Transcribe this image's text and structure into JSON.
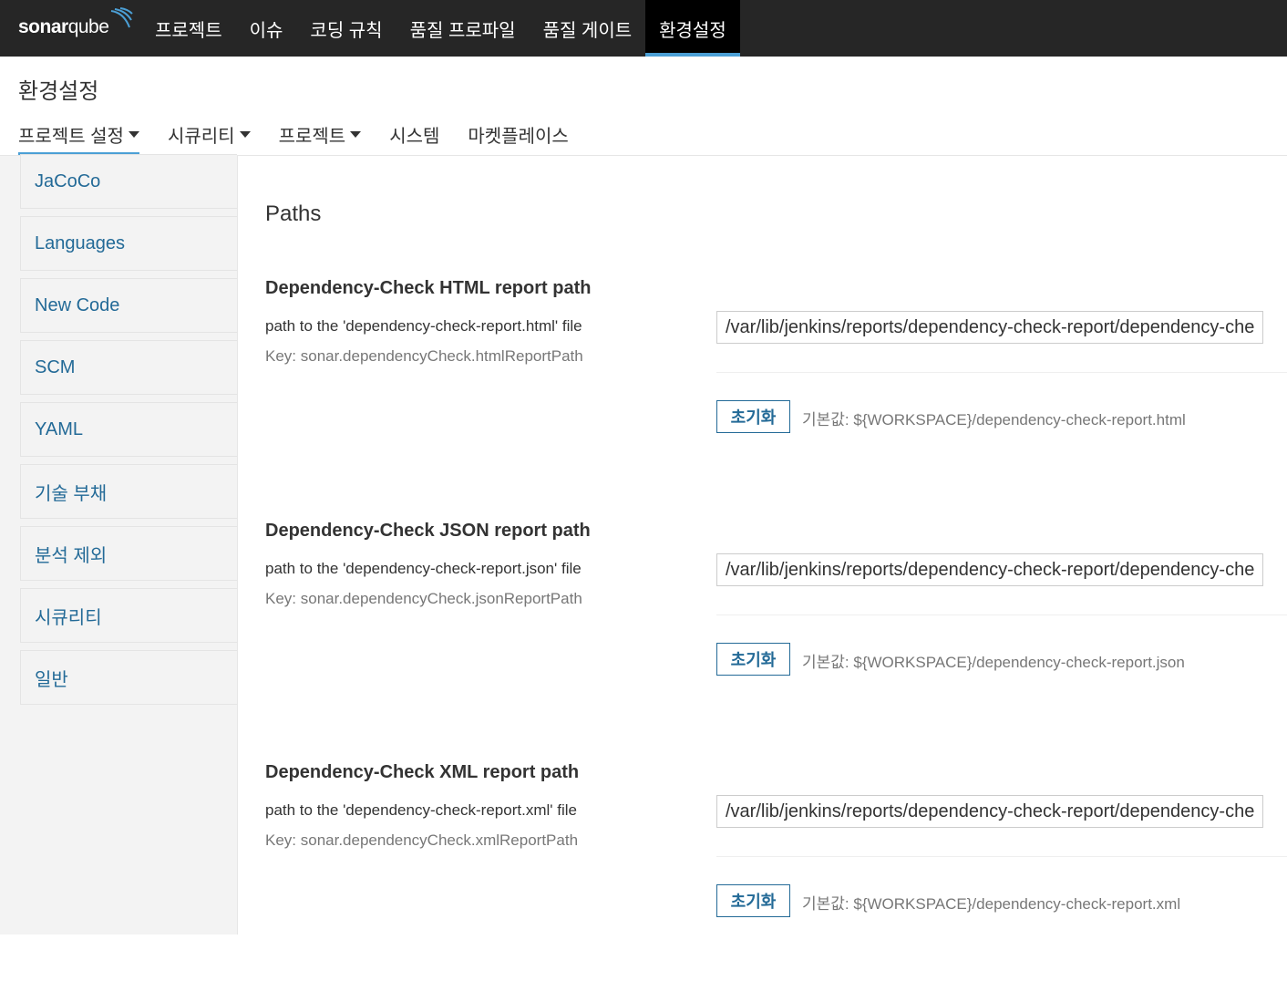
{
  "topbar": {
    "logo_text": "sonar",
    "logo_text2": "qube",
    "nav": [
      {
        "label": "프로젝트"
      },
      {
        "label": "이슈"
      },
      {
        "label": "코딩 규칙"
      },
      {
        "label": "품질 프로파일"
      },
      {
        "label": "품질 게이트"
      },
      {
        "label": "환경설정"
      }
    ],
    "active_index": 5
  },
  "page": {
    "title": "환경설정",
    "tabs": [
      {
        "label": "프로젝트 설정",
        "has_caret": true
      },
      {
        "label": "시큐리티",
        "has_caret": true
      },
      {
        "label": "프로젝트",
        "has_caret": true
      },
      {
        "label": "시스템",
        "has_caret": false
      },
      {
        "label": "마켓플레이스",
        "has_caret": false
      }
    ]
  },
  "sidebar": {
    "items": [
      {
        "label": "JaCoCo"
      },
      {
        "label": "Languages"
      },
      {
        "label": "New Code"
      },
      {
        "label": "SCM"
      },
      {
        "label": "YAML"
      },
      {
        "label": "기술 부채"
      },
      {
        "label": "분석 제외"
      },
      {
        "label": "시큐리티"
      },
      {
        "label": "일반"
      }
    ]
  },
  "main": {
    "section_title": "Paths",
    "settings": [
      {
        "name": "Dependency-Check HTML report path",
        "description": "path to the 'dependency-check-report.html' file",
        "key": "Key: sonar.dependencyCheck.htmlReportPath",
        "value": "/var/lib/jenkins/reports/dependency-check-report/dependency-check-report.html",
        "reset_label": "초기화",
        "default_text": "기본값: ${WORKSPACE}/dependency-check-report.html"
      },
      {
        "name": "Dependency-Check JSON report path",
        "description": "path to the 'dependency-check-report.json' file",
        "key": "Key: sonar.dependencyCheck.jsonReportPath",
        "value": "/var/lib/jenkins/reports/dependency-check-report/dependency-check-report.json",
        "reset_label": "초기화",
        "default_text": "기본값: ${WORKSPACE}/dependency-check-report.json"
      },
      {
        "name": "Dependency-Check XML report path",
        "description": "path to the 'dependency-check-report.xml' file",
        "key": "Key: sonar.dependencyCheck.xmlReportPath",
        "value": "/var/lib/jenkins/reports/dependency-check-report/dependency-check-report.xml",
        "reset_label": "초기화",
        "default_text": "기본값: ${WORKSPACE}/dependency-check-report.xml"
      }
    ]
  }
}
